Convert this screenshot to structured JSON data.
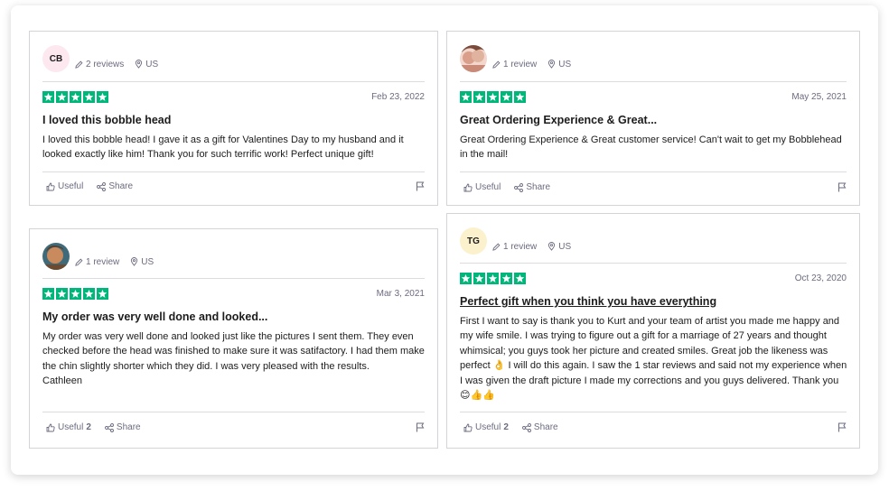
{
  "colors": {
    "star_green": "#00b67a",
    "muted_text": "#6b6b80",
    "border": "#d4d4d8"
  },
  "icons": {
    "pencil": "pencil-icon",
    "location": "location-pin-icon",
    "useful": "thumbs-up-icon",
    "share": "share-icon",
    "flag": "flag-icon"
  },
  "reviews": [
    {
      "avatar_initials": "CB",
      "avatar_bg": "#fde8f0",
      "review_count": "2 reviews",
      "country": "US",
      "rating": 5,
      "date": "Feb 23, 2022",
      "title": "I loved this bobble head",
      "body": "I loved this bobble head! I gave it as a gift for Valentines Day to my husband and it looked exactly like him! Thank you for such terrific work! Perfect unique gift!",
      "useful_label": "Useful",
      "useful_count": "",
      "share_label": "Share"
    },
    {
      "avatar_initials": "",
      "avatar_bg": "#e8b8b0",
      "review_count": "1 review",
      "country": "US",
      "rating": 5,
      "date": "May 25, 2021",
      "title": "Great Ordering Experience & Great...",
      "body": "Great Ordering Experience & Great customer service! Can't wait to get my Bobblehead in the mail!",
      "useful_label": "Useful",
      "useful_count": "",
      "share_label": "Share"
    },
    {
      "avatar_initials": "",
      "avatar_bg": "#6b4a30",
      "review_count": "1 review",
      "country": "US",
      "rating": 5,
      "date": "Mar 3, 2021",
      "title": "My order was very well done and looked...",
      "body": "My order was very well done and looked just like the pictures I sent them. They even checked before the head was finished to make sure it was satifactory. I had them make the chin slightly shorter which they did. I was very pleased with the results.",
      "signature": "Cathleen",
      "useful_label": "Useful",
      "useful_count": "2",
      "share_label": "Share"
    },
    {
      "avatar_initials": "TG",
      "avatar_bg": "#fbf1cc",
      "review_count": "1 review",
      "country": "US",
      "rating": 5,
      "date": "Oct 23, 2020",
      "title": "Perfect gift when you think you have everything",
      "body_part1": "First I want to say is thank you to Kurt and your team of artist you made me happy and my wife smile. I was trying to figure out a gift for a marriage of 27 years and thought whimsical; you guys took her picture and created smiles. Great job the likeness was perfect ",
      "emoji_ok": "👌",
      "body_part2": " I will do this again. I saw the 1 star reviews and said not my experience when I was given the draft picture I made my corrections and you guys delivered. Thank you",
      "emoji_tail": "😊👍👍",
      "useful_label": "Useful",
      "useful_count": "2",
      "share_label": "Share"
    }
  ]
}
